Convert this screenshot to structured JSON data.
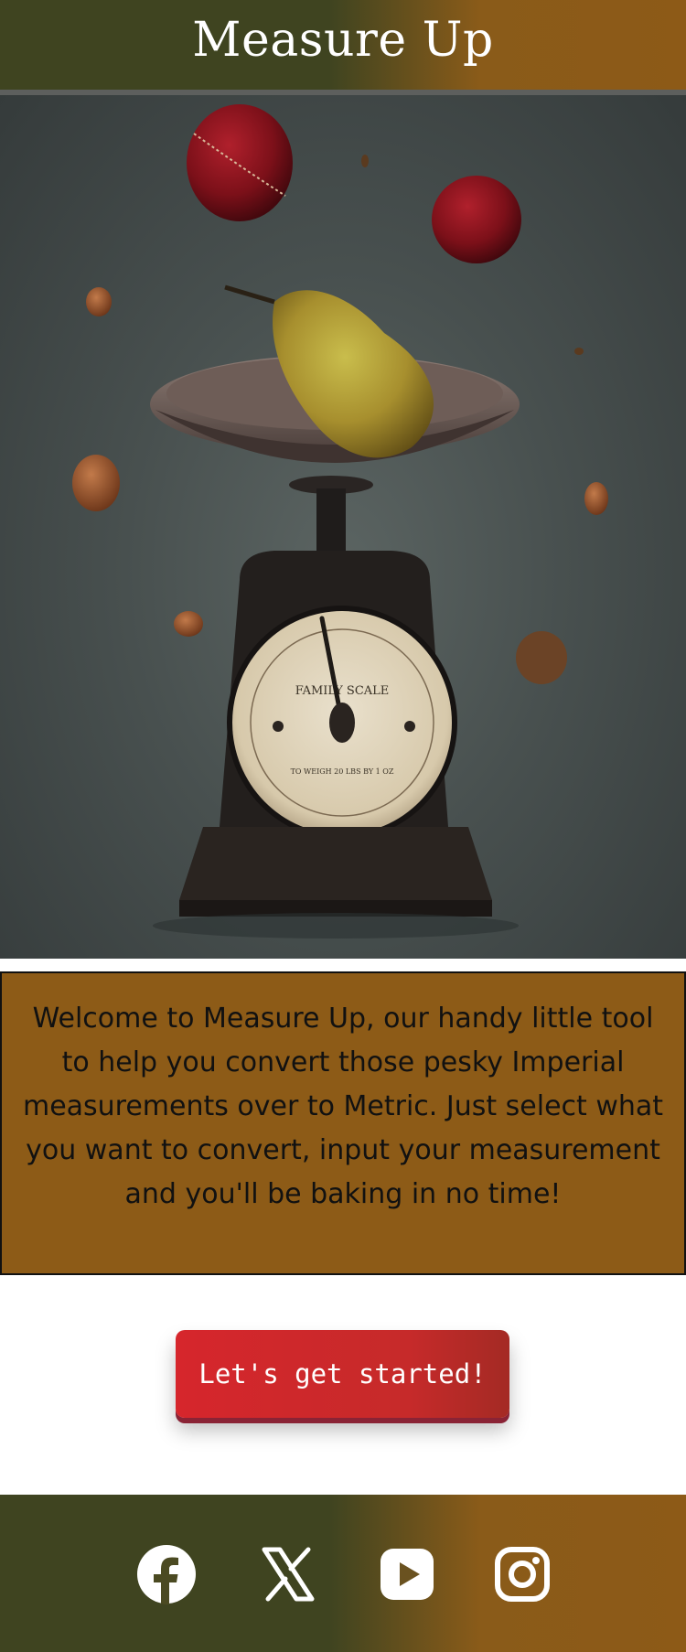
{
  "header": {
    "title": "Measure Up"
  },
  "hero": {
    "image_description_icon": "kitchen-scale-with-fruit-image"
  },
  "intro": {
    "text": "Welcome to Measure Up, our handy little tool to help you convert those pesky Imperial measurements over to Metric. Just select what you want to convert, input your measurement and you'll be baking in no time!"
  },
  "cta": {
    "label": "Let's get started!"
  },
  "footer": {
    "social": [
      {
        "icon": "facebook-icon"
      },
      {
        "icon": "x-twitter-icon"
      },
      {
        "icon": "youtube-icon"
      },
      {
        "icon": "instagram-icon"
      }
    ]
  },
  "colors": {
    "header_green": "#3f4420",
    "header_brown": "#8d5a17",
    "intro_bg": "#8d5b17",
    "cta_red": "#d6262c"
  }
}
